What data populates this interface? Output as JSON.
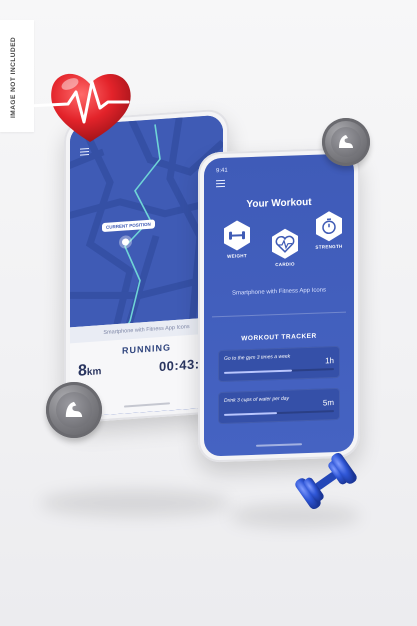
{
  "watermark": "IMAGE NOT INCLUDED",
  "left_phone": {
    "status_time": "",
    "map_label": "CURRENT POSITION",
    "caption": "Smartphone with Fitness App Icons",
    "activity": "RUNNING",
    "distance_value": "8",
    "distance_unit": "km",
    "duration": "00:43:13"
  },
  "right_phone": {
    "status_time": "9:41",
    "title": "Your Workout",
    "categories": [
      {
        "label": "WEIGHT",
        "icon": "dumbbell-icon"
      },
      {
        "label": "CARDIO",
        "icon": "heartbeat-icon"
      },
      {
        "label": "STRENGTH",
        "icon": "stopwatch-icon"
      }
    ],
    "caption": "Smartphone with Fitness App Icons",
    "tracker_title": "WORKOUT TRACKER",
    "tasks": [
      {
        "text": "Go to the gym 3 times a week",
        "value": "1h",
        "progress": 0.62
      },
      {
        "text": "Drink 3 cups of water per day",
        "value": "5m",
        "progress": 0.48
      }
    ]
  },
  "decor": {
    "heart_icon": "heart-pulse-icon",
    "muscle_coin_icon": "flexed-arm-icon",
    "dumbbell_icon": "dumbbell-icon"
  },
  "colors": {
    "screen_blue": "#3f5bb5",
    "heart_red": "#e3232a",
    "dumbbell_blue": "#2f56d6",
    "route_teal": "#6fd4d6"
  }
}
